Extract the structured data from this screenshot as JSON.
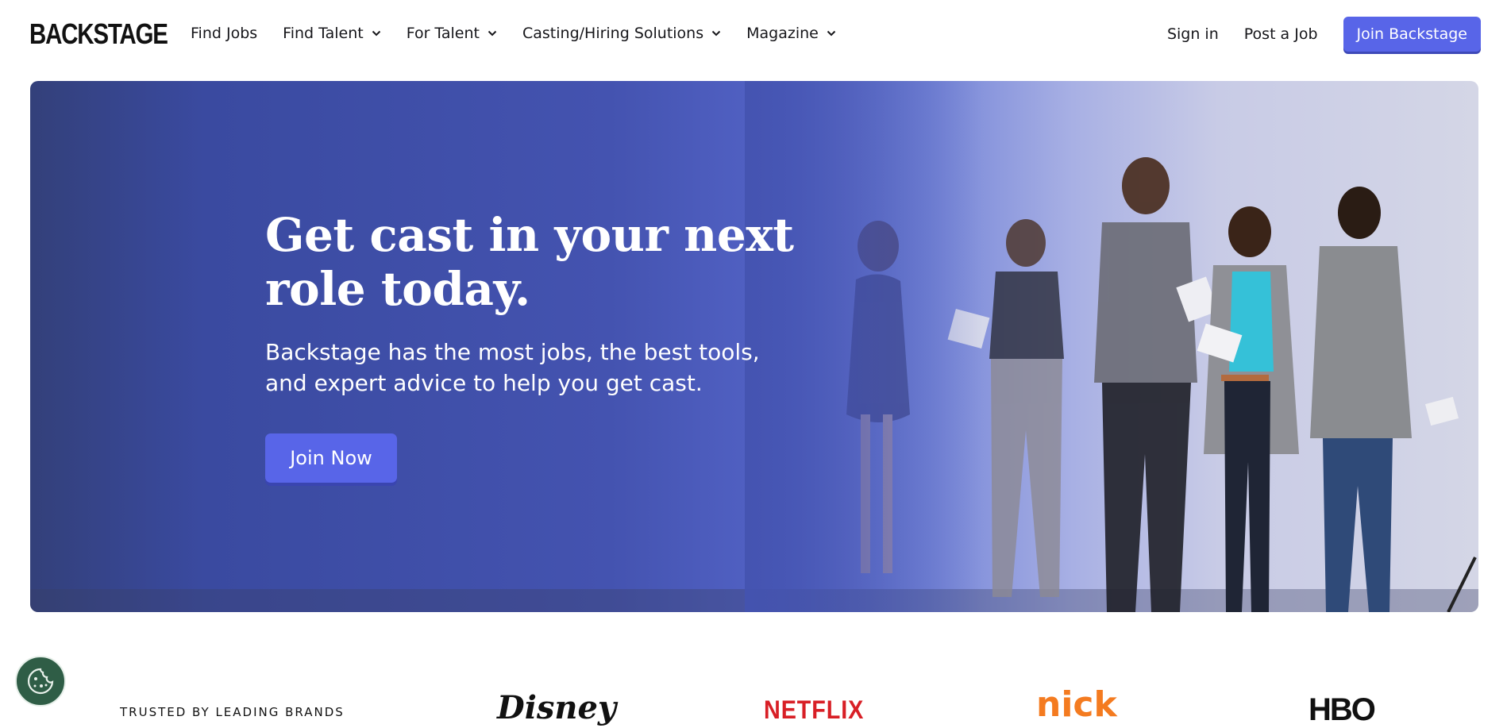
{
  "nav": {
    "logo": "BACKSTAGE",
    "links": [
      {
        "label": "Find Jobs",
        "dropdown": false
      },
      {
        "label": "Find Talent",
        "dropdown": true
      },
      {
        "label": "For Talent",
        "dropdown": true
      },
      {
        "label": "Casting/Hiring Solutions",
        "dropdown": true
      },
      {
        "label": "Magazine",
        "dropdown": true
      }
    ],
    "sign_in": "Sign in",
    "post_job": "Post a Job",
    "join": "Join Backstage"
  },
  "hero": {
    "title": "Get cast in your next role today.",
    "subtitle": "Backstage has the most jobs, the best tools, and expert advice to help you get cast.",
    "cta": "Join Now"
  },
  "brands": {
    "label": "TRUSTED BY LEADING BRANDS",
    "logos": [
      "Disney",
      "NETFLIX",
      "nick",
      "HBO"
    ]
  },
  "colors": {
    "accent": "#5865e8",
    "hero_dark": "#33407a",
    "cookie_bg": "#2f5d46",
    "netflix": "#d81f26",
    "nick": "#f47b20"
  },
  "icons": {
    "chevron": "chevron-down-icon",
    "cookie": "cookie-icon"
  }
}
